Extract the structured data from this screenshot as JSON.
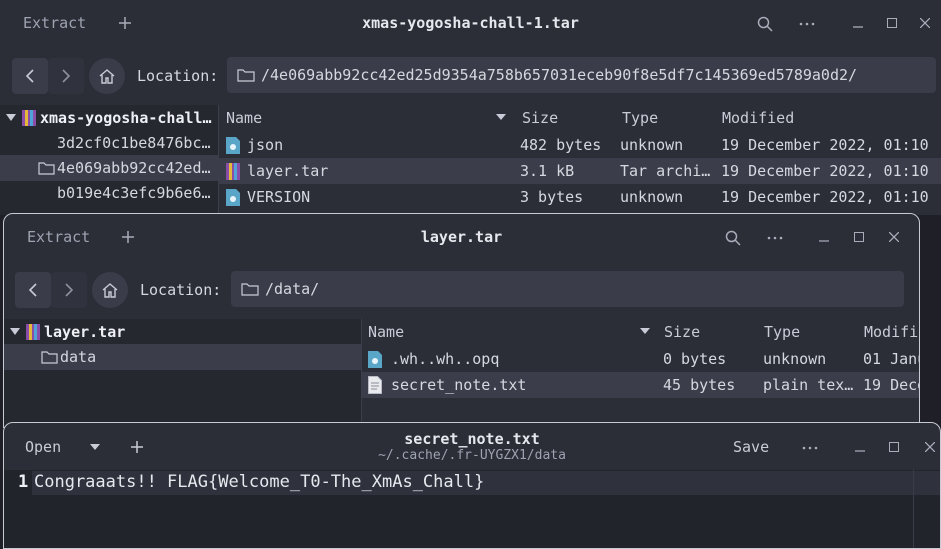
{
  "win1": {
    "extract_label": "Extract",
    "title": "xmas-yogosha-chall-1.tar",
    "location_label": "Location:",
    "location_path": "/4e069abb92cc42ed25d9354a758b657031eceb90f8e5df7c145369ed5789a0d2/",
    "tree": {
      "root": "xmas-yogosha-chall…",
      "items": [
        "3d2cf0c1be8476bc…",
        "4e069abb92cc42ed…",
        "b019e4c3efc9b6e6…"
      ]
    },
    "columns": {
      "name": "Name",
      "size": "Size",
      "type": "Type",
      "modified": "Modified"
    },
    "files": [
      {
        "name": "json",
        "size": "482 bytes",
        "type": "unknown",
        "modified": "19 December 2022, 01:10"
      },
      {
        "name": "layer.tar",
        "size": "3.1 kB",
        "type": "Tar archi…",
        "modified": "19 December 2022, 01:10"
      },
      {
        "name": "VERSION",
        "size": "3 bytes",
        "type": "unknown",
        "modified": "19 December 2022, 01:10"
      }
    ]
  },
  "win2": {
    "extract_label": "Extract",
    "title": "layer.tar",
    "location_label": "Location:",
    "location_path": "/data/",
    "tree": {
      "root": "layer.tar",
      "items": [
        "data"
      ]
    },
    "columns": {
      "name": "Name",
      "size": "Size",
      "type": "Type",
      "modified": "Modifi"
    },
    "files": [
      {
        "name": ".wh..wh..opq",
        "size": "0 bytes",
        "type": "unknown",
        "modified": "01 Janu"
      },
      {
        "name": "secret_note.txt",
        "size": "45 bytes",
        "type": "plain tex…",
        "modified": "19 Dece"
      }
    ]
  },
  "win3": {
    "open_label": "Open",
    "title": "secret_note.txt",
    "subtitle": "~/.cache/.fr-UYGZX1/data",
    "save_label": "Save",
    "line_number": "1",
    "line_text": "Congraaats!! FLAG{Welcome_T0-The_XmAs_Chall}"
  },
  "colors": {
    "bg": "#2b2d37",
    "selected": "#3b3e4a",
    "text": "#d6d8e0"
  },
  "icons": [
    "plus-icon",
    "search-icon",
    "menu-dots-icon",
    "minimize-icon",
    "maximize-icon",
    "close-icon",
    "back-icon",
    "forward-icon",
    "home-icon",
    "folder-icon",
    "archive-icon",
    "file-icon",
    "text-file-icon",
    "sort-down-icon",
    "chevron-down-icon"
  ]
}
